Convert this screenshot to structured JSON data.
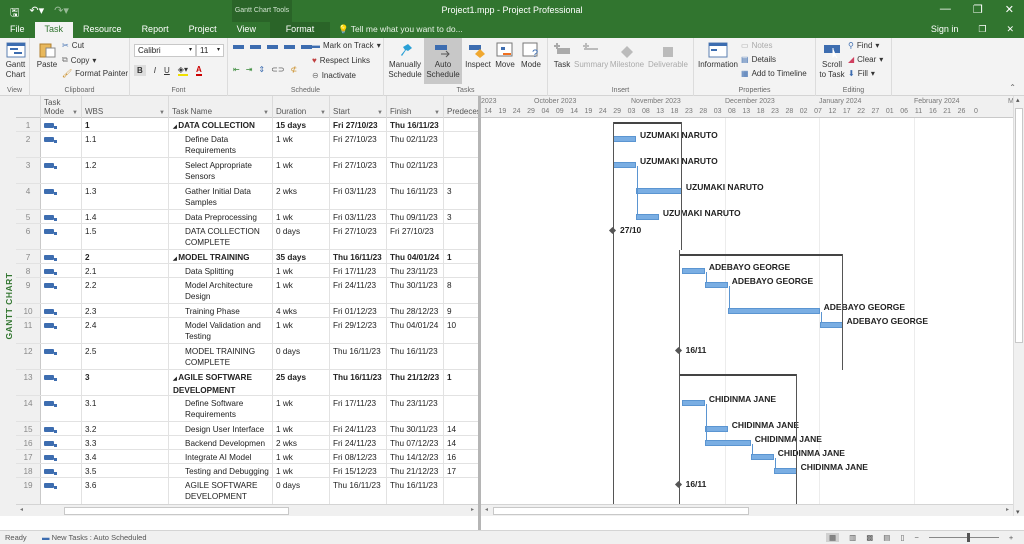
{
  "window": {
    "title": "Project1.mpp - Project Professional",
    "context_tab_group": "Gantt Chart Tools",
    "minimize": "—",
    "restore": "❐",
    "close": "✕"
  },
  "qat": {
    "save_icon": "save-icon",
    "undo_icon": "undo-icon",
    "redo_icon": "redo-icon"
  },
  "tabs": [
    "File",
    "Task",
    "Resource",
    "Report",
    "Project",
    "View"
  ],
  "active_tab": "Task",
  "format_tab": "Format",
  "tell_me": "Tell me what you want to do...",
  "sign_in": "Sign in",
  "ribbon": {
    "view": {
      "label": "View",
      "gantt_chart": "Gantt Chart"
    },
    "clipboard": {
      "label": "Clipboard",
      "paste": "Paste",
      "cut": "Cut",
      "copy": "Copy",
      "format_painter": "Format Painter"
    },
    "font": {
      "label": "Font",
      "font_name": "Calibri",
      "font_size": "11",
      "bold": "B",
      "italic": "I",
      "underline": "U",
      "font_color": "A"
    },
    "schedule": {
      "label": "Schedule",
      "mark_on_track": "Mark on Track",
      "respect_links": "Respect Links",
      "inactivate": "Inactivate"
    },
    "tasks": {
      "label": "Tasks",
      "manually_schedule": "Manually Schedule",
      "auto_schedule": "Auto Schedule",
      "inspect": "Inspect",
      "move": "Move",
      "mode": "Mode"
    },
    "insert": {
      "label": "Insert",
      "task": "Task",
      "summary": "Summary",
      "milestone": "Milestone",
      "deliverable": "Deliverable"
    },
    "properties": {
      "label": "Properties",
      "information": "Information",
      "notes": "Notes",
      "details": "Details",
      "add_to_timeline": "Add to Timeline"
    },
    "editing": {
      "label": "Editing",
      "scroll_to_task": "Scroll to Task",
      "find": "Find",
      "clear": "Clear",
      "fill": "Fill"
    }
  },
  "view_label": "GANTT CHART",
  "columns": [
    "Task Mode",
    "WBS",
    "Task Name",
    "Duration",
    "Start",
    "Finish",
    "Predecessors"
  ],
  "columns_display": [
    "Task Mode",
    "WBS",
    "Task Name",
    "Duration",
    "Start",
    "Finish",
    "Predeces"
  ],
  "tasks": [
    {
      "id": "1",
      "wbs": "1",
      "name": "DATA COLLECTION",
      "duration": "15 days",
      "start": "Fri 27/10/23",
      "finish": "Thu 16/11/23",
      "pred": "",
      "summary": true
    },
    {
      "id": "2",
      "wbs": "1.1",
      "name": "Define Data Requirements",
      "duration": "1 wk",
      "start": "Fri 27/10/23",
      "finish": "Thu 02/11/23",
      "pred": "",
      "resource": "UZUMAKI NARUTO"
    },
    {
      "id": "3",
      "wbs": "1.2",
      "name": "Select Appropriate Sensors",
      "duration": "1 wk",
      "start": "Fri 27/10/23",
      "finish": "Thu 02/11/23",
      "pred": "",
      "resource": "UZUMAKI NARUTO"
    },
    {
      "id": "4",
      "wbs": "1.3",
      "name": "Gather Initial Data Samples",
      "duration": "2 wks",
      "start": "Fri 03/11/23",
      "finish": "Thu 16/11/23",
      "pred": "3",
      "resource": "UZUMAKI NARUTO"
    },
    {
      "id": "5",
      "wbs": "1.4",
      "name": "Data Preprocessing",
      "duration": "1 wk",
      "start": "Fri 03/11/23",
      "finish": "Thu 09/11/23",
      "pred": "3",
      "resource": "UZUMAKI NARUTO"
    },
    {
      "id": "6",
      "wbs": "1.5",
      "name": "DATA COLLECTION COMPLETE",
      "duration": "0 days",
      "start": "Fri 27/10/23",
      "finish": "Fri 27/10/23",
      "pred": "",
      "milestone": true,
      "ms_label": "27/10"
    },
    {
      "id": "7",
      "wbs": "2",
      "name": "MODEL TRAINING",
      "duration": "35 days",
      "start": "Thu 16/11/23",
      "finish": "Thu 04/01/24",
      "pred": "1",
      "summary": true
    },
    {
      "id": "8",
      "wbs": "2.1",
      "name": "Data Splitting",
      "duration": "1 wk",
      "start": "Fri 17/11/23",
      "finish": "Thu 23/11/23",
      "pred": "",
      "resource": "ADEBAYO GEORGE"
    },
    {
      "id": "9",
      "wbs": "2.2",
      "name": "Model Architecture Design",
      "duration": "1 wk",
      "start": "Fri 24/11/23",
      "finish": "Thu 30/11/23",
      "pred": "8",
      "resource": "ADEBAYO GEORGE"
    },
    {
      "id": "10",
      "wbs": "2.3",
      "name": "Training Phase",
      "duration": "4 wks",
      "start": "Fri 01/12/23",
      "finish": "Thu 28/12/23",
      "pred": "9",
      "resource": "ADEBAYO GEORGE"
    },
    {
      "id": "11",
      "wbs": "2.4",
      "name": "Model Validation and Testing",
      "duration": "1 wk",
      "start": "Fri 29/12/23",
      "finish": "Thu 04/01/24",
      "pred": "10",
      "resource": "ADEBAYO GEORGE"
    },
    {
      "id": "12",
      "wbs": "2.5",
      "name": "MODEL TRAINING COMPLETE",
      "duration": "0 days",
      "start": "Thu 16/11/23",
      "finish": "Thu 16/11/23",
      "pred": "",
      "milestone": true,
      "ms_label": "16/11"
    },
    {
      "id": "13",
      "wbs": "3",
      "name": "AGILE SOFTWARE DEVELOPMENT",
      "duration": "25 days",
      "start": "Thu 16/11/23",
      "finish": "Thu 21/12/23",
      "pred": "1",
      "summary": true
    },
    {
      "id": "14",
      "wbs": "3.1",
      "name": "Define Software Requirements",
      "duration": "1 wk",
      "start": "Fri 17/11/23",
      "finish": "Thu 23/11/23",
      "pred": "",
      "resource": "CHIDINMA JANE"
    },
    {
      "id": "15",
      "wbs": "3.2",
      "name": "Design User Interface",
      "duration": "1 wk",
      "start": "Fri 24/11/23",
      "finish": "Thu 30/11/23",
      "pred": "14",
      "resource": "CHIDINMA JANE"
    },
    {
      "id": "16",
      "wbs": "3.3",
      "name": "Backend Developmen",
      "duration": "2 wks",
      "start": "Fri 24/11/23",
      "finish": "Thu 07/12/23",
      "pred": "14",
      "resource": "CHIDINMA JANE"
    },
    {
      "id": "17",
      "wbs": "3.4",
      "name": "Integrate AI Model",
      "duration": "1 wk",
      "start": "Fri 08/12/23",
      "finish": "Thu 14/12/23",
      "pred": "16",
      "resource": "CHIDINMA JANE"
    },
    {
      "id": "18",
      "wbs": "3.5",
      "name": "Testing and Debugging",
      "duration": "1 wk",
      "start": "Fri 15/12/23",
      "finish": "Thu 21/12/23",
      "pred": "17",
      "resource": "CHIDINMA JANE"
    },
    {
      "id": "19",
      "wbs": "3.6",
      "name": "AGILE SOFTWARE DEVELOPMENT COMPLETE",
      "duration": "0 days",
      "start": "Thu 16/11/23",
      "finish": "Thu 16/11/23",
      "pred": "",
      "milestone": true,
      "ms_label": "16/11"
    }
  ],
  "timescale": {
    "months": [
      "2023",
      "October 2023",
      "November 2023",
      "December 2023",
      "January 2024",
      "February 2024",
      "M"
    ],
    "days": [
      "14",
      "19",
      "24",
      "29",
      "04",
      "09",
      "14",
      "19",
      "24",
      "29",
      "03",
      "08",
      "13",
      "18",
      "23",
      "28",
      "03",
      "08",
      "13",
      "18",
      "23",
      "28",
      "02",
      "07",
      "12",
      "17",
      "22",
      "27",
      "01",
      "06",
      "11",
      "16",
      "21",
      "26",
      "0"
    ]
  },
  "status": {
    "ready": "Ready",
    "new_tasks": "New Tasks : Auto Scheduled",
    "zoom_minus": "−",
    "zoom_plus": "+"
  },
  "colors": {
    "brand": "#31752f",
    "task_bar": "#7aaee3",
    "summary": "#444444"
  }
}
